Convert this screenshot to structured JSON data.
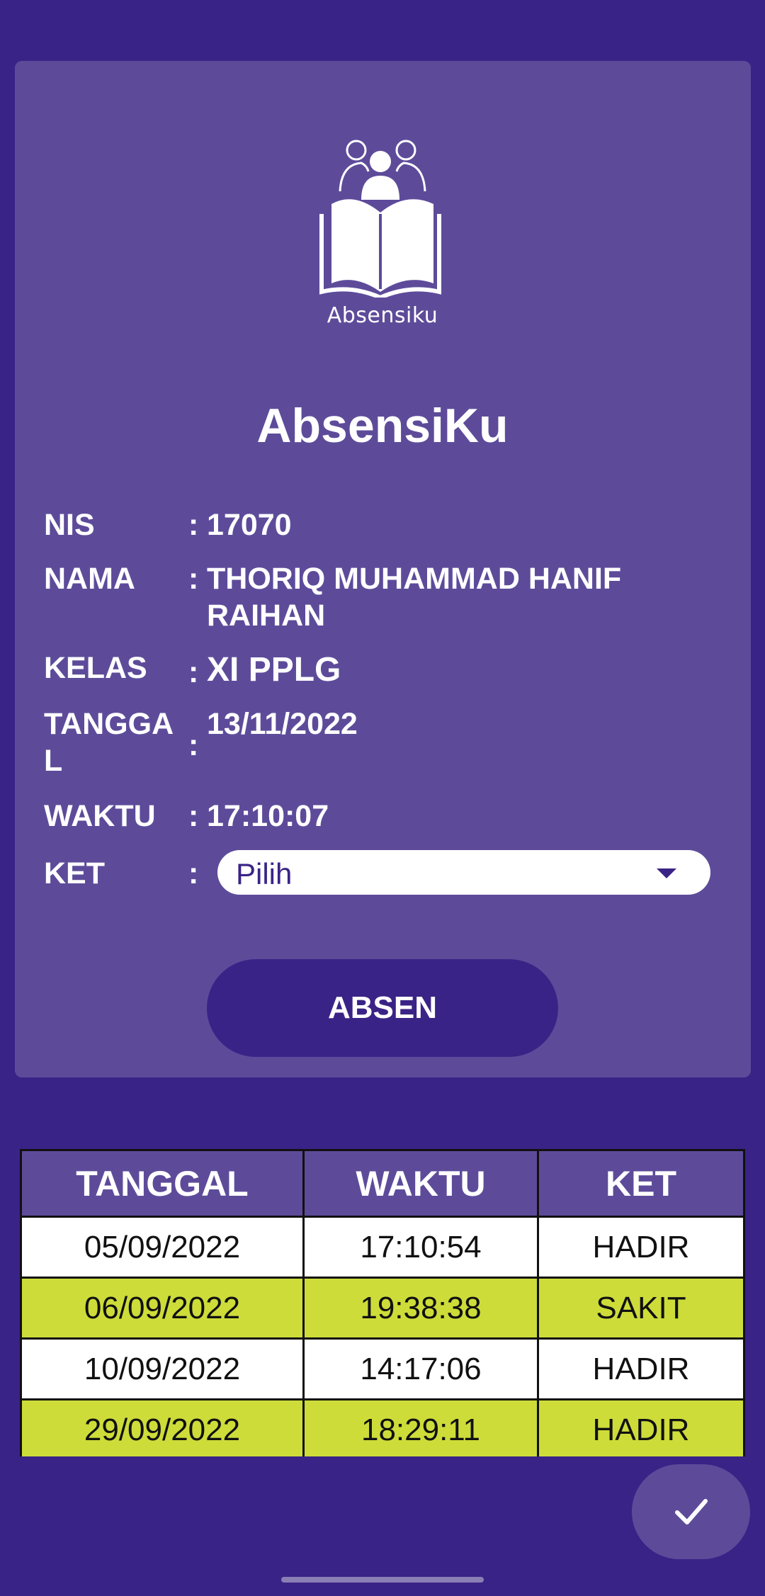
{
  "logo": {
    "icon": "reading-people-book-icon",
    "text": "Absensiku"
  },
  "title": "AbsensiKu",
  "info": {
    "colon": ":",
    "nis_label": "NIS",
    "nis_value": "17070",
    "nama_label": "NAMA",
    "nama_value": "THORIQ MUHAMMAD HANIF RAIHAN",
    "kelas_label": "KELAS",
    "kelas_value": "XI PPLG",
    "tanggal_label": "TANGGA L",
    "tanggal_value": "13/11/2022",
    "waktu_label": "WAKTU",
    "waktu_value": "17:10:07",
    "ket_label": "KET"
  },
  "ket_select": {
    "selected": "Pilih",
    "icon": "dropdown-caret-icon"
  },
  "absen_button": "ABSEN",
  "table": {
    "headers": [
      "TANGGAL",
      "WAKTU",
      "KET"
    ],
    "rows": [
      {
        "tanggal": "05/09/2022",
        "waktu": "17:10:54",
        "ket": "HADIR"
      },
      {
        "tanggal": "06/09/2022",
        "waktu": "19:38:38",
        "ket": "SAKIT"
      },
      {
        "tanggal": "10/09/2022",
        "waktu": "14:17:06",
        "ket": "HADIR"
      },
      {
        "tanggal": "29/09/2022",
        "waktu": "18:29:11",
        "ket": "HADIR"
      }
    ]
  },
  "fab": {
    "icon": "check-icon"
  },
  "colors": {
    "background": "#3a2386",
    "card": "#5d4b9a",
    "row_highlight": "#cddc39",
    "row_plain": "#ffffff"
  }
}
